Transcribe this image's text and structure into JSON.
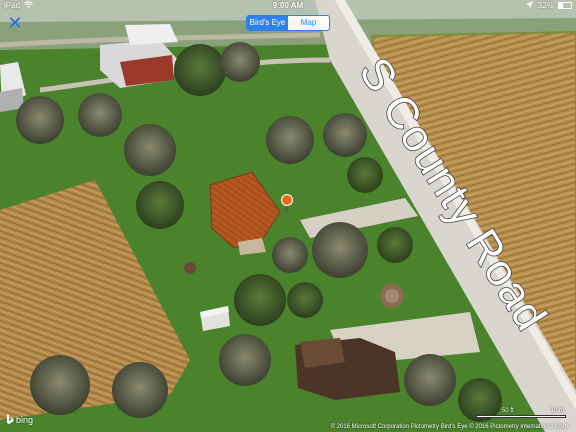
{
  "status_bar": {
    "device": "iPad",
    "time": "9:00 AM",
    "battery": "32%",
    "wifi_icon": "wifi-icon",
    "location_icon": "location-arrow-icon",
    "battery_icon": "battery-icon"
  },
  "toolbar": {
    "close_icon": "close-icon",
    "close_glyph": "✕",
    "segments": [
      {
        "label": "Bird's Eye",
        "active": true
      },
      {
        "label": "Map",
        "active": false
      }
    ]
  },
  "map": {
    "road_label": "S County Road",
    "pin_color": "#f26a1b",
    "colors": {
      "field": "#b58a4a",
      "grass": "#4f8a2f",
      "road": "#e6e3dc",
      "roof": "#b4561f"
    }
  },
  "footer": {
    "logo": "bing",
    "attribution": "© 2016 Microsoft Corporation   Pictometry Bird's Eye © 2016 Pictometry International Corp",
    "scale_labels": [
      "50 ft",
      "10 m"
    ]
  }
}
